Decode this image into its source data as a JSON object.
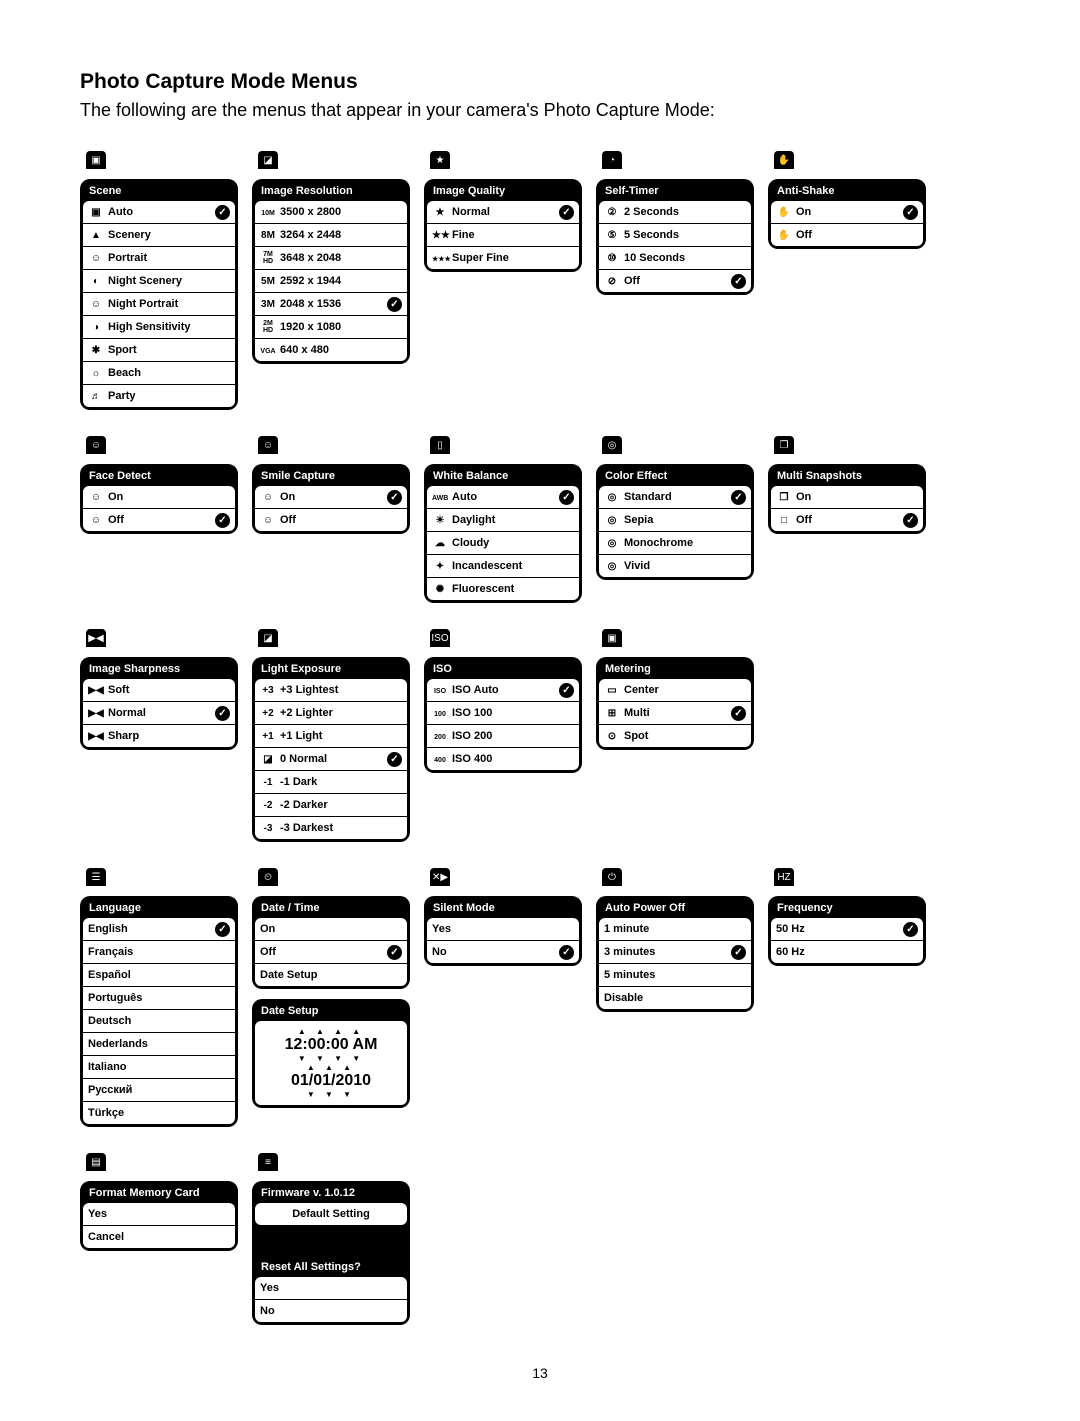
{
  "page": {
    "title": "Photo Capture Mode Menus",
    "intro": "The following are the menus that appear in your camera's Photo Capture Mode:",
    "number": "13"
  },
  "menus": {
    "scene": {
      "title": "Scene",
      "items": [
        {
          "icon": "▣",
          "label": "Auto",
          "sel": true
        },
        {
          "icon": "▲",
          "label": "Scenery"
        },
        {
          "icon": "☺",
          "label": "Portrait"
        },
        {
          "icon": "◐",
          "label": "Night Scenery"
        },
        {
          "icon": "☺",
          "label": "Night Portrait"
        },
        {
          "icon": "◑",
          "label": "High Sensitivity"
        },
        {
          "icon": "✱",
          "label": "Sport"
        },
        {
          "icon": "☼",
          "label": "Beach"
        },
        {
          "icon": "♬",
          "label": "Party"
        }
      ]
    },
    "resolution": {
      "title": "Image Resolution",
      "items": [
        {
          "icon": "10M",
          "label": "3500 x 2800"
        },
        {
          "icon": "8M",
          "label": "3264 x 2448"
        },
        {
          "icon": "7M HD",
          "label": "3648 x 2048"
        },
        {
          "icon": "5M",
          "label": "2592 x 1944"
        },
        {
          "icon": "3M",
          "label": "2048 x 1536",
          "sel": true
        },
        {
          "icon": "2M HD",
          "label": "1920 x 1080"
        },
        {
          "icon": "VGA",
          "label": "640 x 480"
        }
      ]
    },
    "quality": {
      "title": "Image Quality",
      "items": [
        {
          "icon": "★",
          "label": "Normal",
          "sel": true
        },
        {
          "icon": "★★",
          "label": "Fine"
        },
        {
          "icon": "★★★",
          "label": "Super Fine"
        }
      ]
    },
    "selftimer": {
      "title": "Self-Timer",
      "items": [
        {
          "icon": "②",
          "label": "2 Seconds"
        },
        {
          "icon": "⑤",
          "label": "5 Seconds"
        },
        {
          "icon": "⑩",
          "label": "10 Seconds"
        },
        {
          "icon": "⊘",
          "label": "Off",
          "sel": true
        }
      ]
    },
    "antishake": {
      "title": "Anti-Shake",
      "items": [
        {
          "icon": "✋",
          "label": "On",
          "sel": true
        },
        {
          "icon": "✋",
          "label": "Off"
        }
      ]
    },
    "facedetect": {
      "title": "Face Detect",
      "items": [
        {
          "icon": "☺",
          "label": "On"
        },
        {
          "icon": "☺",
          "label": "Off",
          "sel": true
        }
      ]
    },
    "smile": {
      "title": "Smile Capture",
      "items": [
        {
          "icon": "☺",
          "label": "On",
          "sel": true
        },
        {
          "icon": "☺",
          "label": "Off"
        }
      ]
    },
    "wb": {
      "title": "White Balance",
      "items": [
        {
          "icon": "AWB",
          "label": "Auto",
          "sel": true
        },
        {
          "icon": "☀",
          "label": "Daylight"
        },
        {
          "icon": "☁",
          "label": "Cloudy"
        },
        {
          "icon": "✦",
          "label": "Incandescent"
        },
        {
          "icon": "✺",
          "label": "Fluorescent"
        }
      ]
    },
    "coloreffect": {
      "title": "Color Effect",
      "items": [
        {
          "icon": "◎",
          "label": "Standard",
          "sel": true
        },
        {
          "icon": "◎",
          "label": "Sepia"
        },
        {
          "icon": "◎",
          "label": "Monochrome"
        },
        {
          "icon": "◎",
          "label": "Vivid"
        }
      ]
    },
    "multisnap": {
      "title": "Multi Snapshots",
      "items": [
        {
          "icon": "❐",
          "label": "On"
        },
        {
          "icon": "□",
          "label": "Off",
          "sel": true
        }
      ]
    },
    "sharpness": {
      "title": "Image Sharpness",
      "items": [
        {
          "icon": "▶◀",
          "label": "Soft"
        },
        {
          "icon": "▶◀",
          "label": "Normal",
          "sel": true
        },
        {
          "icon": "▶◀",
          "label": "Sharp"
        }
      ]
    },
    "exposure": {
      "title": "Light Exposure",
      "items": [
        {
          "icon": "+3",
          "label": "+3 Lightest"
        },
        {
          "icon": "+2",
          "label": "+2 Lighter"
        },
        {
          "icon": "+1",
          "label": "+1 Light"
        },
        {
          "icon": "◪",
          "label": "0 Normal",
          "sel": true
        },
        {
          "icon": "-1",
          "label": "-1 Dark"
        },
        {
          "icon": "-2",
          "label": "-2 Darker"
        },
        {
          "icon": "-3",
          "label": "-3 Darkest"
        }
      ]
    },
    "iso": {
      "title": "ISO",
      "items": [
        {
          "icon": "ISO",
          "label": "ISO Auto",
          "sel": true
        },
        {
          "icon": "100",
          "label": "ISO 100"
        },
        {
          "icon": "200",
          "label": "ISO 200"
        },
        {
          "icon": "400",
          "label": "ISO 400"
        }
      ]
    },
    "metering": {
      "title": "Metering",
      "items": [
        {
          "icon": "▭",
          "label": "Center"
        },
        {
          "icon": "⊞",
          "label": "Multi",
          "sel": true
        },
        {
          "icon": "⊙",
          "label": "Spot"
        }
      ]
    },
    "language": {
      "title": "Language",
      "items": [
        {
          "label": "English",
          "sel": true
        },
        {
          "label": "Français"
        },
        {
          "label": "Español"
        },
        {
          "label": "Português"
        },
        {
          "label": "Deutsch"
        },
        {
          "label": "Nederlands"
        },
        {
          "label": "Italiano"
        },
        {
          "label": "Русский"
        },
        {
          "label": "Türkçe"
        }
      ]
    },
    "datetime": {
      "title": "Date / Time",
      "items": [
        {
          "label": "On"
        },
        {
          "label": "Off",
          "sel": true
        },
        {
          "label": "Date Setup"
        }
      ],
      "setup_title": "Date Setup",
      "time": "12:00:00 AM",
      "date": "01/01/2010"
    },
    "silent": {
      "title": "Silent Mode",
      "items": [
        {
          "label": "Yes"
        },
        {
          "label": "No",
          "sel": true
        }
      ]
    },
    "autopoweroff": {
      "title": "Auto Power Off",
      "items": [
        {
          "label": "1 minute"
        },
        {
          "label": "3 minutes",
          "sel": true
        },
        {
          "label": "5 minutes"
        },
        {
          "label": "Disable"
        }
      ]
    },
    "frequency": {
      "title": "Frequency",
      "items": [
        {
          "label": "50 Hz",
          "sel": true
        },
        {
          "label": "60 Hz"
        }
      ]
    },
    "format": {
      "title": "Format Memory Card",
      "items": [
        {
          "label": "Yes"
        },
        {
          "label": "Cancel"
        }
      ]
    },
    "firmware": {
      "title": "Firmware v. 1.0.12",
      "default": "Default Setting",
      "reset_title": "Reset All Settings?",
      "reset_items": [
        {
          "label": "Yes"
        },
        {
          "label": "No"
        }
      ]
    }
  }
}
